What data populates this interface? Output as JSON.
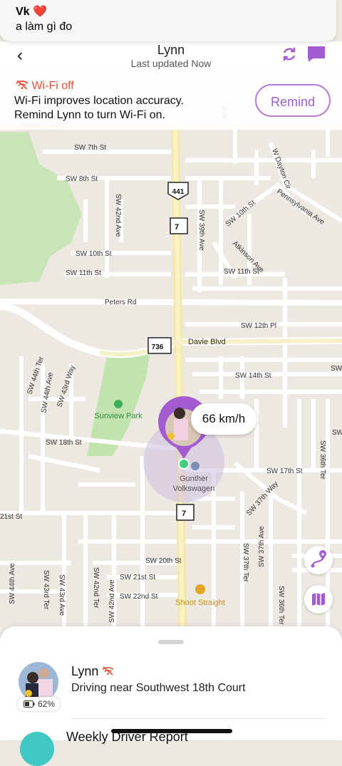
{
  "notification": {
    "sender": "Vk ❤️",
    "message": "a làm gì đo"
  },
  "nav": {
    "back_icon": "chevron-left",
    "title": "Lynn",
    "subtitle": "Last updated Now",
    "refresh_icon": "refresh-icon",
    "chat_icon": "chat-icon",
    "accent": "#a35bd0"
  },
  "banner": {
    "header": "Wi-Fi off",
    "line1": "Wi-Fi improves location accuracy.",
    "line2": "Remind Lynn to turn Wi-Fi on.",
    "remind_label": "Remind",
    "header_color": "#e0533a"
  },
  "map": {
    "streets": [
      "SW 7th St",
      "SW 8th St",
      "SW 10th St",
      "SW 11th St",
      "Peters Rd",
      "Davie Blvd",
      "SW 12th Pl",
      "SW 14th St",
      "SW 18th St",
      "SW 17th St",
      "SW 20th St",
      "SW 21st St",
      "SW 22nd St",
      "21st St",
      "SW 42nd Ave",
      "SW 39th Ave",
      "SW 10th St",
      "SW 11th St",
      "Atkinson Ave",
      "Pennsylvania Ave",
      "W Dayton Cir",
      "SW 44th Ter",
      "SW 44th Ave",
      "SW 43rd Way",
      "SW 37th Way",
      "SW 36th Ter",
      "SW 37th Ter",
      "SW 37th Ave",
      "SW 44th Ave",
      "SW 43rd Ter",
      "SW 43rd Ave",
      "SW 42nd Ter",
      "SW 42nd Ave",
      "SW 36th Ter",
      "Country Club"
    ],
    "shields": [
      "441",
      "7",
      "736",
      "7"
    ],
    "poi": [
      "Sunview Park",
      "Shoot Straight"
    ],
    "place_label": "Gunther Volkswagen",
    "speed": "66 km/h"
  },
  "sheet": {
    "member_name": "Lynn",
    "member_status": "Driving near Southwest 18th Court",
    "battery": "62%",
    "next_item": "Weekly Driver Report"
  }
}
